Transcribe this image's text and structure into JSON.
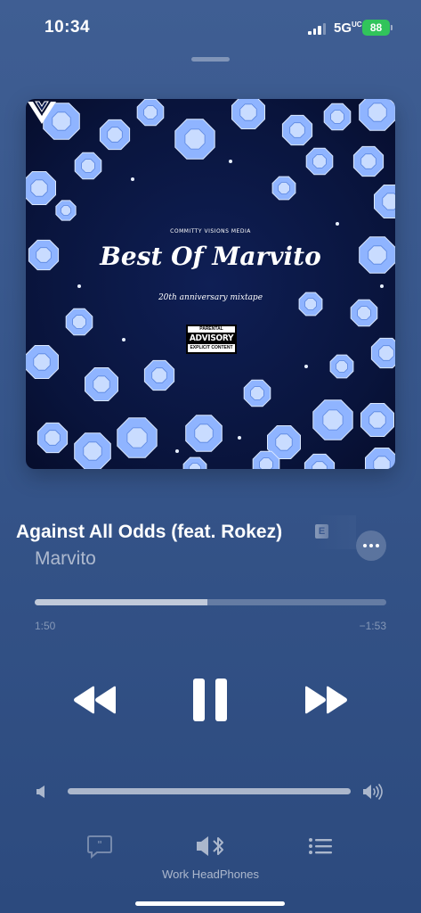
{
  "status_bar": {
    "time": "10:34",
    "network": "5G",
    "network_suffix": "UC",
    "battery": "88"
  },
  "artwork": {
    "brand": "COMMITTY VISIONS MEDIA",
    "title": "Best Of Marvito",
    "subtitle": "20th anniversary mixtape",
    "advisory_top": "PARENTAL",
    "advisory_main": "ADVISORY",
    "advisory_bottom": "EXPLICIT CONTENT"
  },
  "track": {
    "title": "Against All Odds (feat. Rokez)",
    "explicit_badge": "E",
    "artist": "Marvito"
  },
  "playback": {
    "elapsed": "1:50",
    "remaining": "−1:53",
    "progress_fraction": 0.49,
    "volume_fraction": 1.0,
    "state": "playing"
  },
  "output": {
    "device": "Work HeadPhones"
  },
  "icons": {
    "rewind": "backward-icon",
    "pause": "pause-icon",
    "forward": "forward-icon",
    "lyrics": "lyrics-icon",
    "airplay": "bluetooth-speaker-icon",
    "queue": "queue-icon"
  },
  "colors": {
    "background": "#36558a",
    "battery": "#31c45b",
    "artwork_bg": "#09143c",
    "diamond": "#8fb4ff"
  }
}
